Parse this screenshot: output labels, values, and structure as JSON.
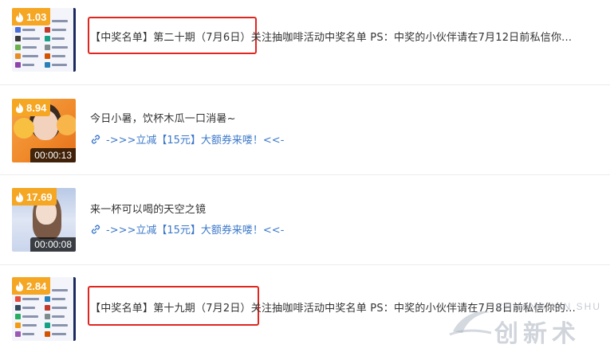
{
  "items": [
    {
      "heat": "1.03",
      "thumbnail": "winner-list-image",
      "title_highlight": "【中奖名单】第二十期（7月6日）",
      "title_rest": "关注抽咖啡活动中奖名单 PS：中奖的小伙伴请在7月12日前私信你..."
    },
    {
      "heat": "8.94",
      "thumbnail": "video-woman-with-papaya",
      "duration": "00:00:13",
      "title": "今日小暑，饮杯木瓜一口消暑~",
      "link_icon": "link-icon",
      "promo_link": "->>>立减【15元】大额券来喽！<<-"
    },
    {
      "heat": "17.69",
      "thumbnail": "video-woman-sky",
      "duration": "00:00:08",
      "title": "来一杯可以喝的天空之镜",
      "link_icon": "link-icon",
      "promo_link": "->>>立减【15元】大额券来喽！<<-"
    },
    {
      "heat": "2.84",
      "thumbnail": "winner-list-image",
      "title_highlight": "【中奖名单】第十九期（7月2日）",
      "title_rest": "关注抽咖啡活动中奖名单 PS：中奖的小伙伴请在7月8日前私信你的..."
    }
  ],
  "watermark": {
    "pinyin": "CHUANG XIN SHU",
    "text": "创新术"
  },
  "colors": {
    "heat_badge": "#f5a623",
    "highlight_border": "#e0261f",
    "link": "#3b78c9",
    "title": "#333333"
  }
}
